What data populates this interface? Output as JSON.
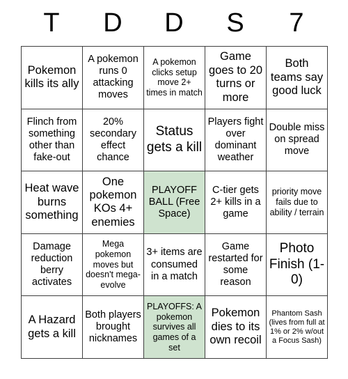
{
  "card": {
    "header_letters": [
      "T",
      "D",
      "D",
      "S",
      "7"
    ],
    "free_space_color": "#cfe3cf",
    "border_color": "#3f3f3f",
    "background_color": "#ffffff",
    "rows": 5,
    "columns": 5,
    "cells": [
      {
        "text": "Pokemon kills its ally",
        "free": false,
        "size": "fs-lg"
      },
      {
        "text": "A pokemon runs 0 attacking moves",
        "free": false,
        "size": "fs-md"
      },
      {
        "text": "A pokemon clicks setup move 2+ times in match",
        "free": false,
        "size": "fs-sm"
      },
      {
        "text": "Game goes to 20 turns or more",
        "free": false,
        "size": "fs-lg"
      },
      {
        "text": "Both teams say good luck",
        "free": false,
        "size": "fs-lg"
      },
      {
        "text": "Flinch from something other than fake-out",
        "free": false,
        "size": "fs-md"
      },
      {
        "text": "20% secondary effect chance",
        "free": false,
        "size": "fs-md"
      },
      {
        "text": "Status gets a kill",
        "free": false,
        "size": "fs-xl"
      },
      {
        "text": "Players fight over dominant weather",
        "free": false,
        "size": "fs-md"
      },
      {
        "text": "Double miss on spread move",
        "free": false,
        "size": "fs-md"
      },
      {
        "text": "Heat wave burns something",
        "free": false,
        "size": "fs-lg"
      },
      {
        "text": "One pokemon KOs 4+ enemies",
        "free": false,
        "size": "fs-lg"
      },
      {
        "text": "PLAYOFF BALL (Free Space)",
        "free": true,
        "size": "fs-md"
      },
      {
        "text": "C-tier gets 2+ kills in a game",
        "free": false,
        "size": "fs-md"
      },
      {
        "text": "priority move fails due to ability / terrain",
        "free": false,
        "size": "fs-sm"
      },
      {
        "text": "Damage reduction berry activates",
        "free": false,
        "size": "fs-md"
      },
      {
        "text": "Mega pokemon moves but doesn't mega-evolve",
        "free": false,
        "size": "fs-sm"
      },
      {
        "text": "3+ items are consumed in a match",
        "free": false,
        "size": "fs-md"
      },
      {
        "text": "Game restarted for some reason",
        "free": false,
        "size": "fs-md"
      },
      {
        "text": "Photo Finish (1-0)",
        "free": false,
        "size": "fs-xl"
      },
      {
        "text": "A Hazard gets a kill",
        "free": false,
        "size": "fs-lg"
      },
      {
        "text": "Both players brought nicknames",
        "free": false,
        "size": "fs-md"
      },
      {
        "text": "PLAYOFFS: A pokemon survives all games of a set",
        "free": true,
        "size": "fs-sm"
      },
      {
        "text": "Pokemon dies to its own recoil",
        "free": false,
        "size": "fs-lg"
      },
      {
        "text": "Phantom Sash (lives from full at 1% or 2% w/out a Focus Sash)",
        "free": false,
        "size": "fs-xs"
      }
    ]
  }
}
